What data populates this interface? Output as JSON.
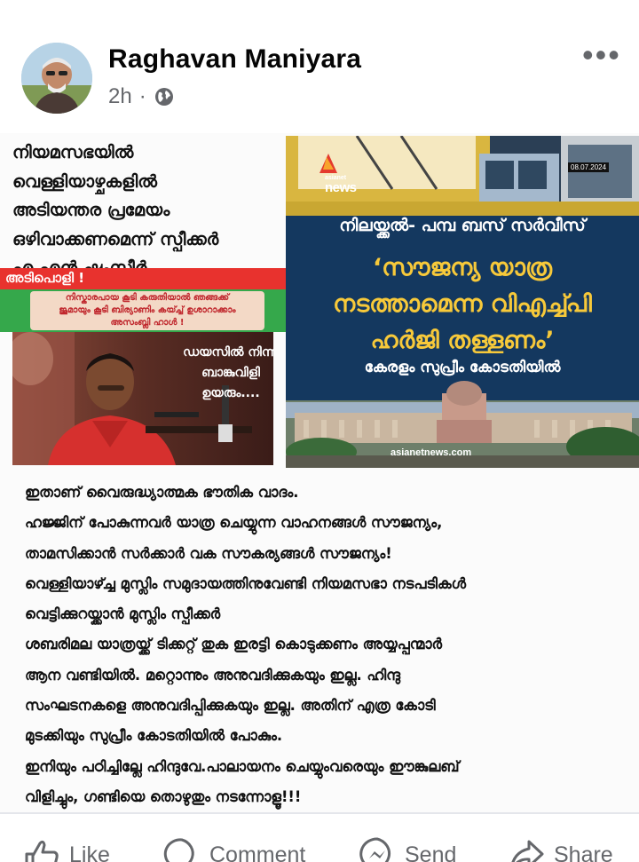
{
  "post": {
    "author": "Raghavan Maniyara",
    "time": "2h",
    "separator": "·",
    "privacy_icon": "globe-icon",
    "more_icon": "more-options-icon",
    "more_symbol": "•••"
  },
  "image": {
    "left_heading_lines": [
      "നിയമസഭയിൽ",
      "വെള്ളിയാഴ്ചകളിൽ",
      "അടിയന്തര പ്രമേയം",
      "ഒഴിവാക്കണമെന്ന് സ്പീക്കർ",
      "എ എൻ ഷംസീർ"
    ],
    "banner_red": "അടിപൊളി !",
    "banner_green_lines": [
      "നിസ്കാരപായ കൂടി കരുതിയാൽ ഞങ്ങക്ക്",
      "ജുമായും കൂടി ബിര്യാണിം കയ്ച്ച് ഉശാറാക്കാം",
      "അസംബ്ലി ഹാൾ !"
    ],
    "photo_quote_lines": [
      "ഡയസിൽ നിന്നു",
      "ബാങ്കുവിളി",
      "ഉയരും...."
    ],
    "news": {
      "date": "08.07.2024",
      "logo_sub": "asianet",
      "logo_main": "news",
      "route": "നിലയ്ക്കൽ- പമ്പ ബസ് സർവീസ്",
      "headline_lines": [
        "‘സൗജന്യ യാത്ര",
        "നടത്താമെന്ന വിഎച്ച്പി",
        "ഹർജി തള്ളണം’"
      ],
      "sub": "കേരളം സുപ്രീം കോടതിയിൽ",
      "watermark": "asianetnews.com"
    },
    "body_lines": [
      "ഇതാണ് വൈരുദ്ധ്യാത്മക ഭൗതിക വാദം.",
      "ഹജ്ജിന് പോകുന്നവർ യാത്ര ചെയ്യുന്ന വാഹനങ്ങൾ സൗജന്യം,",
      "താമസിക്കാൻ സർക്കാർ വക സൗകര്യങ്ങൾ സൗജന്യം!",
      "വെള്ളിയാഴ്ച്ച മുസ്ലിം സമുദായത്തിനുവേണ്ടി നിയമസഭാ നടപടികൾ",
      "വെട്ടിക്കുറയ്ക്കാൻ മുസ്ലിം സ്പീക്കർ",
      "ശബരിമല യാത്രയ്ക്ക് ടിക്കറ്റ് തുക ഇരട്ടി കൊടുക്കണം അയ്യപ്പന്മാർ",
      "ആന വണ്ടിയിൽ. മറ്റൊന്നും അനുവദിക്കുകയും ഇല്ല. ഹിന്ദു",
      "സംഘടനകളെ അനുവദിപ്പിക്കുകയും ഇല്ല. അതിന് എത്ര കോടി",
      "മുടക്കിയും സുപ്രീം കോടതിയിൽ പോകും.",
      "ഇനിയും പഠിച്ചില്ലേ ഹിന്ദുവേ.പാലായനം ചെയ്യുംവരെയും ഈങ്കുലബ്",
      "വിളിച്ചും, ഗണ്ടിയെ തൊഴുതും നടന്നോളൂ!!!"
    ]
  },
  "actions": [
    {
      "label": "Like",
      "icon": "thumbs-up-icon"
    },
    {
      "label": "Comment",
      "icon": "comment-icon"
    },
    {
      "label": "Send",
      "icon": "messenger-icon"
    },
    {
      "label": "Share",
      "icon": "share-icon"
    }
  ]
}
